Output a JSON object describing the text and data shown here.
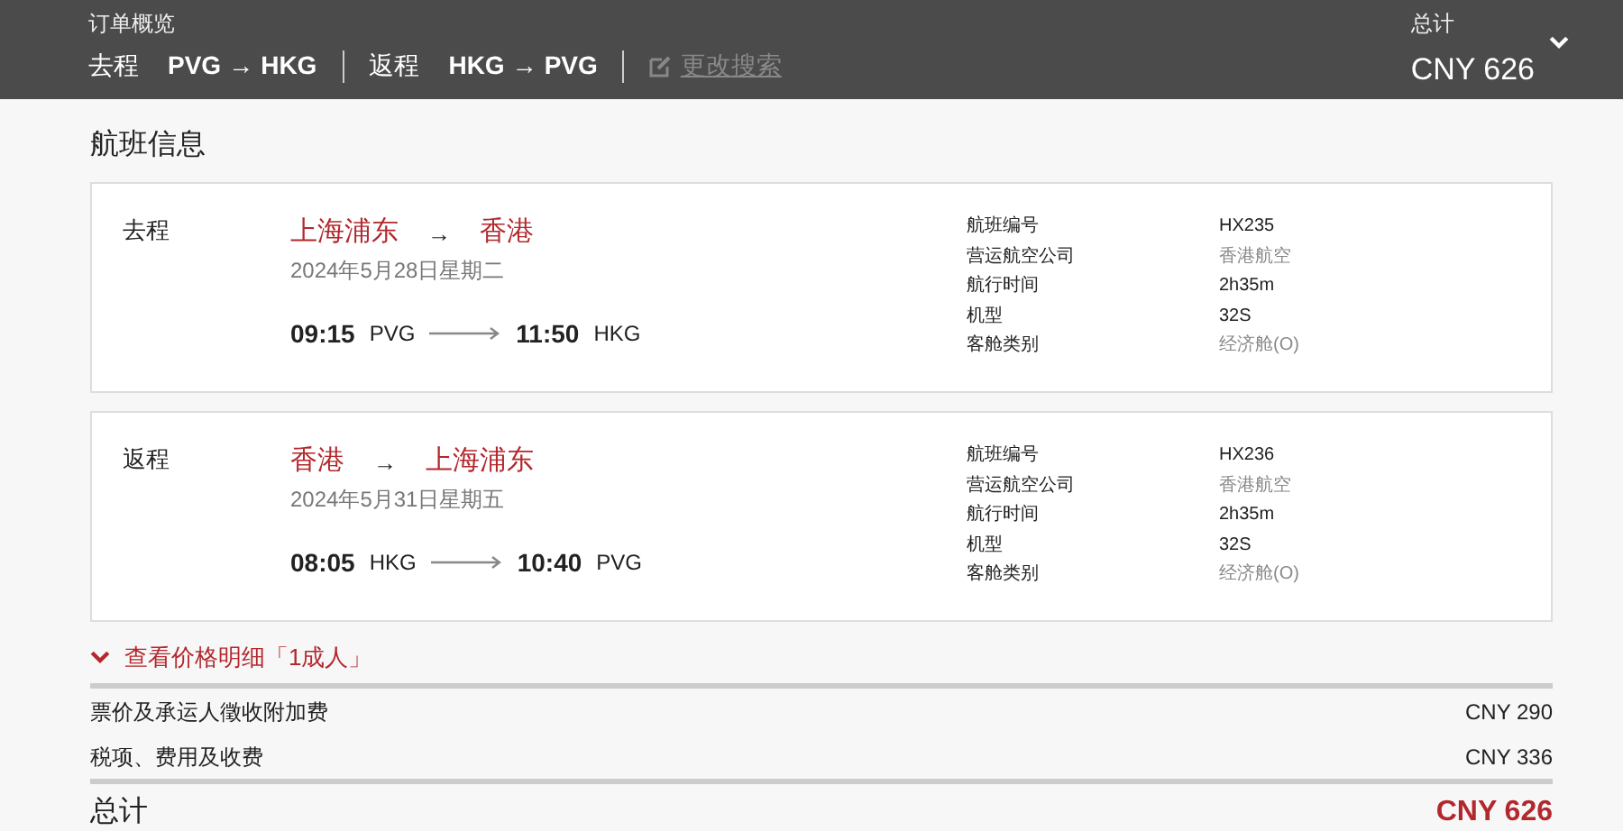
{
  "header": {
    "title": "订单概览",
    "legs": [
      {
        "label": "去程",
        "from": "PVG",
        "arrow": "→",
        "to": "HKG"
      },
      {
        "label": "返程",
        "from": "HKG",
        "arrow": "→",
        "to": "PVG"
      }
    ],
    "edit_search": {
      "label": "更改搜索",
      "disabled": true
    },
    "total_label": "总计",
    "total": "CNY 626",
    "expanded": false
  },
  "section_title": "航班信息",
  "flights": [
    {
      "label": "去程",
      "from_city": "上海浦东",
      "arrow": "→",
      "to_city": "香港",
      "date": "2024年5月28日星期二",
      "dep_time": "09:15",
      "dep_code": "PVG",
      "arr_time": "11:50",
      "arr_code": "HKG",
      "details": [
        {
          "label": "航班编号",
          "value": "HX235",
          "muted": false
        },
        {
          "label": "营运航空公司",
          "value": "香港航空",
          "muted": true
        },
        {
          "label": "航行时间",
          "value": "2h35m",
          "muted": false
        },
        {
          "label": "机型",
          "value": "32S",
          "muted": false
        },
        {
          "label": "客舱类别",
          "value": "经济舱(O)",
          "muted": true
        }
      ]
    },
    {
      "label": "返程",
      "from_city": "香港",
      "arrow": "→",
      "to_city": "上海浦东",
      "date": "2024年5月31日星期五",
      "dep_time": "08:05",
      "dep_code": "HKG",
      "arr_time": "10:40",
      "arr_code": "PVG",
      "details": [
        {
          "label": "航班编号",
          "value": "HX236",
          "muted": false
        },
        {
          "label": "营运航空公司",
          "value": "香港航空",
          "muted": true
        },
        {
          "label": "航行时间",
          "value": "2h35m",
          "muted": false
        },
        {
          "label": "机型",
          "value": "32S",
          "muted": false
        },
        {
          "label": "客舱类别",
          "value": "经济舱(O)",
          "muted": true
        }
      ]
    }
  ],
  "price_toggle": {
    "label": "查看价格明细「1成人」",
    "expanded": false
  },
  "price_rows": [
    {
      "label": "票价及承运人徵收附加费",
      "amount": "CNY 290"
    },
    {
      "label": "税项、费用及收费",
      "amount": "CNY 336"
    }
  ],
  "total": {
    "label": "总计",
    "amount": "CNY 626"
  }
}
